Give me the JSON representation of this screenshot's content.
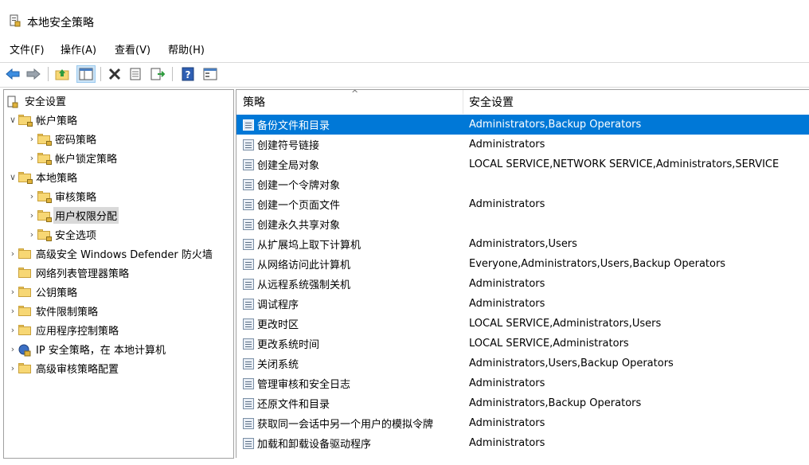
{
  "window": {
    "title": "本地安全策略",
    "icon": "security-policy-icon"
  },
  "menubar": {
    "items": [
      "文件(F)",
      "操作(A)",
      "查看(V)",
      "帮助(H)"
    ]
  },
  "toolbar": {
    "buttons": [
      "back-arrow-icon",
      "forward-arrow-icon",
      "up-folder-icon",
      "show-hide-tree-icon",
      "delete-icon",
      "properties-icon",
      "export-list-icon",
      "help-icon",
      "console-tree-icon"
    ]
  },
  "tree": {
    "root": "安全设置",
    "items": [
      {
        "label": "帐户策略"
      },
      {
        "label": "密码策略"
      },
      {
        "label": "帐户锁定策略"
      },
      {
        "label": "本地策略"
      },
      {
        "label": "审核策略"
      },
      {
        "label": "用户权限分配"
      },
      {
        "label": "安全选项"
      },
      {
        "label": "高级安全 Windows Defender 防火墙"
      },
      {
        "label": "网络列表管理器策略"
      },
      {
        "label": "公钥策略"
      },
      {
        "label": "软件限制策略"
      },
      {
        "label": "应用程序控制策略"
      },
      {
        "label": "IP 安全策略，在 本地计算机"
      },
      {
        "label": "高级审核策略配置"
      }
    ]
  },
  "list": {
    "columns": [
      "策略",
      "安全设置"
    ],
    "sort_indicator": "^",
    "rows": [
      {
        "policy": "备份文件和目录",
        "setting": "Administrators,Backup Operators"
      },
      {
        "policy": "创建符号链接",
        "setting": "Administrators"
      },
      {
        "policy": "创建全局对象",
        "setting": "LOCAL SERVICE,NETWORK SERVICE,Administrators,SERVICE"
      },
      {
        "policy": "创建一个令牌对象",
        "setting": ""
      },
      {
        "policy": "创建一个页面文件",
        "setting": "Administrators"
      },
      {
        "policy": "创建永久共享对象",
        "setting": ""
      },
      {
        "policy": "从扩展坞上取下计算机",
        "setting": "Administrators,Users"
      },
      {
        "policy": "从网络访问此计算机",
        "setting": "Everyone,Administrators,Users,Backup Operators"
      },
      {
        "policy": "从远程系统强制关机",
        "setting": "Administrators"
      },
      {
        "policy": "调试程序",
        "setting": "Administrators"
      },
      {
        "policy": "更改时区",
        "setting": "LOCAL SERVICE,Administrators,Users"
      },
      {
        "policy": "更改系统时间",
        "setting": "LOCAL SERVICE,Administrators"
      },
      {
        "policy": "关闭系统",
        "setting": "Administrators,Users,Backup Operators"
      },
      {
        "policy": "管理审核和安全日志",
        "setting": "Administrators"
      },
      {
        "policy": "还原文件和目录",
        "setting": "Administrators,Backup Operators"
      },
      {
        "policy": "获取同一会话中另一个用户的模拟令牌",
        "setting": "Administrators"
      },
      {
        "policy": "加载和卸载设备驱动程序",
        "setting": "Administrators"
      }
    ]
  },
  "colors": {
    "selection": "#0078d7",
    "tree_selection": "#d9d9d9"
  }
}
